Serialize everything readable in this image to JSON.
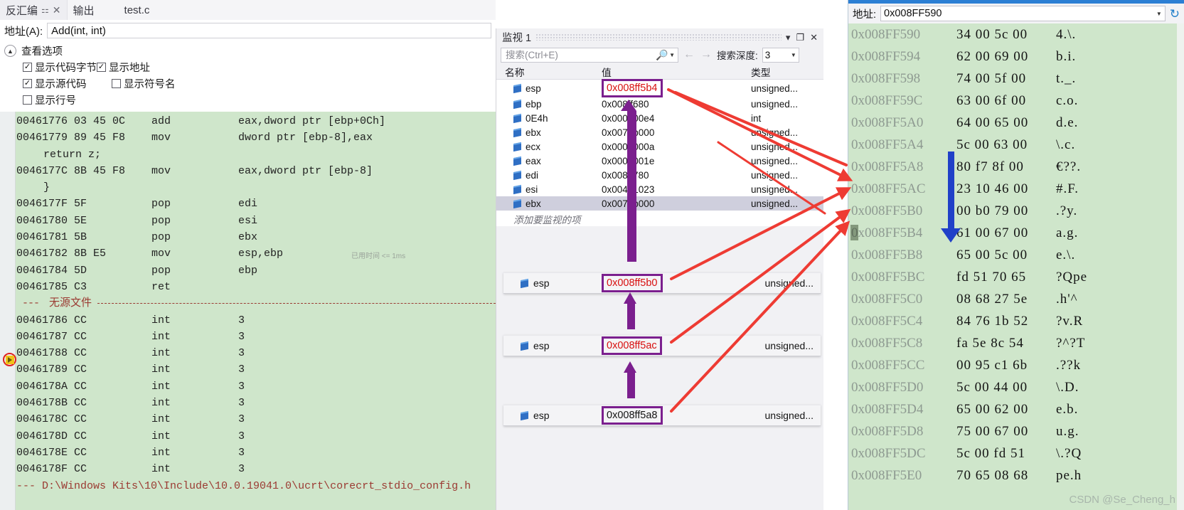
{
  "disassembly": {
    "tabs": [
      {
        "label": "反汇编",
        "active": true,
        "pin": "⚏",
        "close": "✕"
      },
      {
        "label": "输出",
        "active": false
      },
      {
        "label": "test.c",
        "active": false
      }
    ],
    "address_label": "地址(A):",
    "address_value": "Add(int, int)",
    "view_options_label": "查看选项",
    "options": [
      {
        "label": "显示代码字节",
        "checked": true
      },
      {
        "label": "显示地址",
        "checked": true
      },
      {
        "label": "显示源代码",
        "checked": true
      },
      {
        "label": "显示符号名",
        "checked": false
      },
      {
        "label": "显示行号",
        "checked": false
      }
    ],
    "lines": [
      {
        "type": "asm",
        "addr": "00461776 03 45 0C",
        "mn": "add",
        "op": "eax,dword ptr [ebp+0Ch]"
      },
      {
        "type": "asm",
        "addr": "00461779 89 45 F8",
        "mn": "mov",
        "op": "dword ptr [ebp-8],eax"
      },
      {
        "type": "src",
        "text": "return z;"
      },
      {
        "type": "asm",
        "addr": "0046177C 8B 45 F8",
        "mn": "mov",
        "op": "eax,dword ptr [ebp-8]"
      },
      {
        "type": "src",
        "text": "}"
      },
      {
        "type": "asm",
        "addr": "0046177F 5F",
        "mn": "pop",
        "op": "edi"
      },
      {
        "type": "asm",
        "addr": "00461780 5E",
        "mn": "pop",
        "op": "esi"
      },
      {
        "type": "asm",
        "addr": "00461781 5B",
        "mn": "pop",
        "op": "ebx"
      },
      {
        "type": "asm",
        "addr": "00461782 8B E5",
        "mn": "mov",
        "op": "esp,ebp",
        "current": true,
        "timing": "已用时间 <= 1ms"
      },
      {
        "type": "asm",
        "addr": "00461784 5D",
        "mn": "pop",
        "op": "ebp"
      },
      {
        "type": "asm",
        "addr": "00461785 C3",
        "mn": "ret",
        "op": ""
      },
      {
        "type": "nosrc",
        "text": "无源文件"
      },
      {
        "type": "asm",
        "addr": "00461786 CC",
        "mn": "int",
        "op": "3"
      },
      {
        "type": "asm",
        "addr": "00461787 CC",
        "mn": "int",
        "op": "3"
      },
      {
        "type": "asm",
        "addr": "00461788 CC",
        "mn": "int",
        "op": "3"
      },
      {
        "type": "asm",
        "addr": "00461789 CC",
        "mn": "int",
        "op": "3"
      },
      {
        "type": "asm",
        "addr": "0046178A CC",
        "mn": "int",
        "op": "3"
      },
      {
        "type": "asm",
        "addr": "0046178B CC",
        "mn": "int",
        "op": "3"
      },
      {
        "type": "asm",
        "addr": "0046178C CC",
        "mn": "int",
        "op": "3"
      },
      {
        "type": "asm",
        "addr": "0046178D CC",
        "mn": "int",
        "op": "3"
      },
      {
        "type": "asm",
        "addr": "0046178E CC",
        "mn": "int",
        "op": "3"
      },
      {
        "type": "asm",
        "addr": "0046178F CC",
        "mn": "int",
        "op": "3"
      },
      {
        "type": "filepath",
        "text": "--- D:\\Windows Kits\\10\\Include\\10.0.19041.0\\ucrt\\corecrt_stdio_config.h"
      }
    ]
  },
  "watch": {
    "title": "监视 1",
    "window_buttons": {
      "dropdown": "▾",
      "maximize": "❐",
      "close": "✕"
    },
    "search_placeholder": "搜索(Ctrl+E)",
    "search_value": "",
    "search_icon": "search-icon",
    "nav_back": "←",
    "nav_forward": "→",
    "depth_label": "搜索深度:",
    "depth_value": "3",
    "columns": {
      "name": "名称",
      "value": "值",
      "type": "类型"
    },
    "rows": [
      {
        "name": "esp",
        "value": "0x008ff5b4",
        "type": "unsigned...",
        "highlight": true,
        "selected": false
      },
      {
        "name": "ebp",
        "value": "0x008ff680",
        "type": "unsigned...",
        "highlight": false,
        "selected": false
      },
      {
        "name": "0E4h",
        "value": "0x000000e4",
        "type": "int",
        "highlight": false,
        "selected": false
      },
      {
        "name": "ebx",
        "value": "0x0079b000",
        "type": "unsigned...",
        "highlight": false,
        "selected": false
      },
      {
        "name": "ecx",
        "value": "0x0000000a",
        "type": "unsigned...",
        "highlight": false,
        "selected": false
      },
      {
        "name": "eax",
        "value": "0x0000001e",
        "type": "unsigned...",
        "highlight": false,
        "selected": false
      },
      {
        "name": "edi",
        "value": "0x008ff780",
        "type": "unsigned...",
        "highlight": false,
        "selected": false
      },
      {
        "name": "esi",
        "value": "0x00461023",
        "type": "unsigned...",
        "highlight": false,
        "selected": false
      },
      {
        "name": "ebx",
        "value": "0x0079b000",
        "type": "unsigned...",
        "highlight": false,
        "selected": true
      }
    ],
    "add_watch_hint": "添加要监视的项",
    "floating_cards": [
      {
        "name": "esp",
        "value": "0x008ff5b0",
        "type": "unsigned...",
        "boxed": true
      },
      {
        "name": "esp",
        "value": "0x008ff5ac",
        "type": "unsigned...",
        "boxed": true
      },
      {
        "name": "esp",
        "value": "0x008ff5a8",
        "type": "unsigned...",
        "boxed": true
      }
    ]
  },
  "memory": {
    "address_label": "地址:",
    "address_value": "0x008FF590",
    "dropdown_icon": "chevron-down-icon",
    "refresh_icon": "refresh-icon",
    "rows": [
      {
        "addr": "0x008FF590",
        "hex": "34 00 5c 00",
        "ascii": "4.\\."
      },
      {
        "addr": "0x008FF594",
        "hex": "62 00 69 00",
        "ascii": "b.i."
      },
      {
        "addr": "0x008FF598",
        "hex": "74 00 5f 00",
        "ascii": "t._."
      },
      {
        "addr": "0x008FF59C",
        "hex": "63 00 6f 00",
        "ascii": "c.o."
      },
      {
        "addr": "0x008FF5A0",
        "hex": "64 00 65 00",
        "ascii": "d.e."
      },
      {
        "addr": "0x008FF5A4",
        "hex": "5c 00 63 00",
        "ascii": "\\.c."
      },
      {
        "addr": "0x008FF5A8",
        "hex": "80 f7 8f 00",
        "ascii": "€??."
      },
      {
        "addr": "0x008FF5AC",
        "hex": "23 10 46 00",
        "ascii": "#.F."
      },
      {
        "addr": "0x008FF5B0",
        "hex": "00 b0 79 00",
        "ascii": ".?y."
      },
      {
        "addr": "0x008FF5B4",
        "hex": "61 00 67 00",
        "ascii": "a.g.",
        "cursor": true
      },
      {
        "addr": "0x008FF5B8",
        "hex": "65 00 5c 00",
        "ascii": "e.\\."
      },
      {
        "addr": "0x008FF5BC",
        "hex": "fd 51 70 65",
        "ascii": "?Qpe"
      },
      {
        "addr": "0x008FF5C0",
        "hex": "08 68 27 5e",
        "ascii": ".h'^"
      },
      {
        "addr": "0x008FF5C4",
        "hex": "84 76 1b 52",
        "ascii": "?v.R"
      },
      {
        "addr": "0x008FF5C8",
        "hex": "fa 5e 8c 54",
        "ascii": "?^?T"
      },
      {
        "addr": "0x008FF5CC",
        "hex": "00 95 c1 6b",
        "ascii": ".??k"
      },
      {
        "addr": "0x008FF5D0",
        "hex": "5c 00 44 00",
        "ascii": "\\.D."
      },
      {
        "addr": "0x008FF5D4",
        "hex": "65 00 62 00",
        "ascii": "e.b."
      },
      {
        "addr": "0x008FF5D8",
        "hex": "75 00 67 00",
        "ascii": "u.g."
      },
      {
        "addr": "0x008FF5DC",
        "hex": "5c 00 fd 51",
        "ascii": "\\.?Q"
      },
      {
        "addr": "0x008FF5E0",
        "hex": "70 65 08 68",
        "ascii": "pe.h"
      }
    ],
    "watermark": "CSDN @Se_Cheng_h"
  },
  "colors": {
    "code_bg": "#cfe6cb",
    "annotation_red": "#ee3b33",
    "annotation_purple": "#7b1f8e",
    "value_red": "#d81010",
    "blue_arrow": "#2040c8",
    "accent_blue": "#2c7fd4"
  }
}
